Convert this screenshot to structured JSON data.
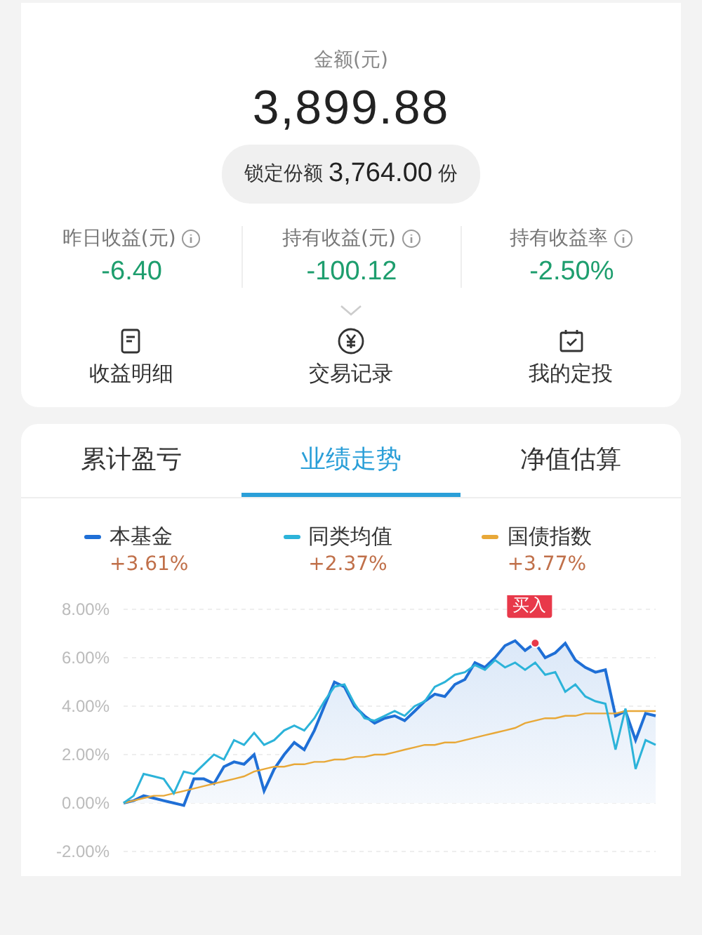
{
  "holding": {
    "amount_label": "金额(元)",
    "amount": "3,899.88",
    "locked": {
      "label": "锁定份额",
      "value": "3,764.00",
      "unit": "份"
    }
  },
  "stats": [
    {
      "label": "昨日收益(元)",
      "value": "-6.40"
    },
    {
      "label": "持有收益(元)",
      "value": "-100.12"
    },
    {
      "label": "持有收益率",
      "value": "-2.50%"
    }
  ],
  "actions": [
    {
      "kind": "document",
      "label": "收益明细"
    },
    {
      "kind": "yuan",
      "label": "交易记录"
    },
    {
      "kind": "calendar",
      "label": "我的定投"
    }
  ],
  "tabs": [
    {
      "label": "累计盈亏",
      "selected": false
    },
    {
      "label": "业绩走势",
      "selected": true
    },
    {
      "label": "净值估算",
      "selected": false
    }
  ],
  "legend": [
    {
      "change": "+3.61%"
    },
    {
      "change": "+2.37%"
    },
    {
      "change": "+3.77%"
    }
  ],
  "chart_data": {
    "type": "line",
    "grid": true,
    "ylim": [
      -2,
      8
    ],
    "yticks": [
      {
        "value": 8,
        "label": "8.00%"
      },
      {
        "value": 6,
        "label": "6.00%"
      },
      {
        "value": 4,
        "label": "4.00%"
      },
      {
        "value": 2,
        "label": "2.00%"
      },
      {
        "value": 0,
        "label": "0.00%"
      },
      {
        "value": -2,
        "label": "-2.00%"
      }
    ],
    "series": [
      {
        "name": "本基金",
        "type": "area",
        "color": "#1f6fd6",
        "values": [
          0,
          0.1,
          0.3,
          0.2,
          0.1,
          0,
          -0.1,
          1.0,
          1.0,
          0.8,
          1.5,
          1.7,
          1.6,
          2.0,
          0.5,
          1.4,
          2.0,
          2.5,
          2.2,
          3.0,
          4.0,
          5.0,
          4.8,
          4.0,
          3.6,
          3.3,
          3.5,
          3.6,
          3.4,
          3.8,
          4.2,
          4.5,
          4.4,
          4.9,
          5.1,
          5.8,
          5.6,
          6.0,
          6.5,
          6.7,
          6.3,
          6.6,
          6.0,
          6.2,
          6.6,
          5.9,
          5.6,
          5.4,
          5.5,
          3.6,
          3.8,
          2.6,
          3.7,
          3.6
        ]
      },
      {
        "name": "同类均值",
        "type": "line",
        "color": "#2cb3d9",
        "values": [
          0,
          0.3,
          1.2,
          1.1,
          1.0,
          0.4,
          1.3,
          1.2,
          1.6,
          2.0,
          1.8,
          2.6,
          2.4,
          2.9,
          2.4,
          2.6,
          3.0,
          3.2,
          3.0,
          3.5,
          4.2,
          4.8,
          4.9,
          4.1,
          3.5,
          3.4,
          3.6,
          3.8,
          3.6,
          4.0,
          4.2,
          4.8,
          5.0,
          5.3,
          5.4,
          5.7,
          5.5,
          5.9,
          5.6,
          5.8,
          5.5,
          5.8,
          5.3,
          5.4,
          4.6,
          4.9,
          4.4,
          4.2,
          4.1,
          2.2,
          3.9,
          1.4,
          2.6,
          2.4
        ]
      },
      {
        "name": "国债指数",
        "type": "line",
        "color": "#e8a838",
        "values": [
          0,
          0.1,
          0.2,
          0.3,
          0.3,
          0.4,
          0.5,
          0.6,
          0.7,
          0.8,
          0.9,
          1.0,
          1.1,
          1.3,
          1.4,
          1.5,
          1.5,
          1.6,
          1.6,
          1.7,
          1.7,
          1.8,
          1.8,
          1.9,
          1.9,
          2.0,
          2.0,
          2.1,
          2.2,
          2.3,
          2.4,
          2.4,
          2.5,
          2.5,
          2.6,
          2.7,
          2.8,
          2.9,
          3.0,
          3.1,
          3.3,
          3.4,
          3.5,
          3.5,
          3.6,
          3.6,
          3.7,
          3.7,
          3.7,
          3.7,
          3.8,
          3.8,
          3.8,
          3.8
        ]
      }
    ],
    "annotations": [
      {
        "text": "买入"
      }
    ]
  }
}
